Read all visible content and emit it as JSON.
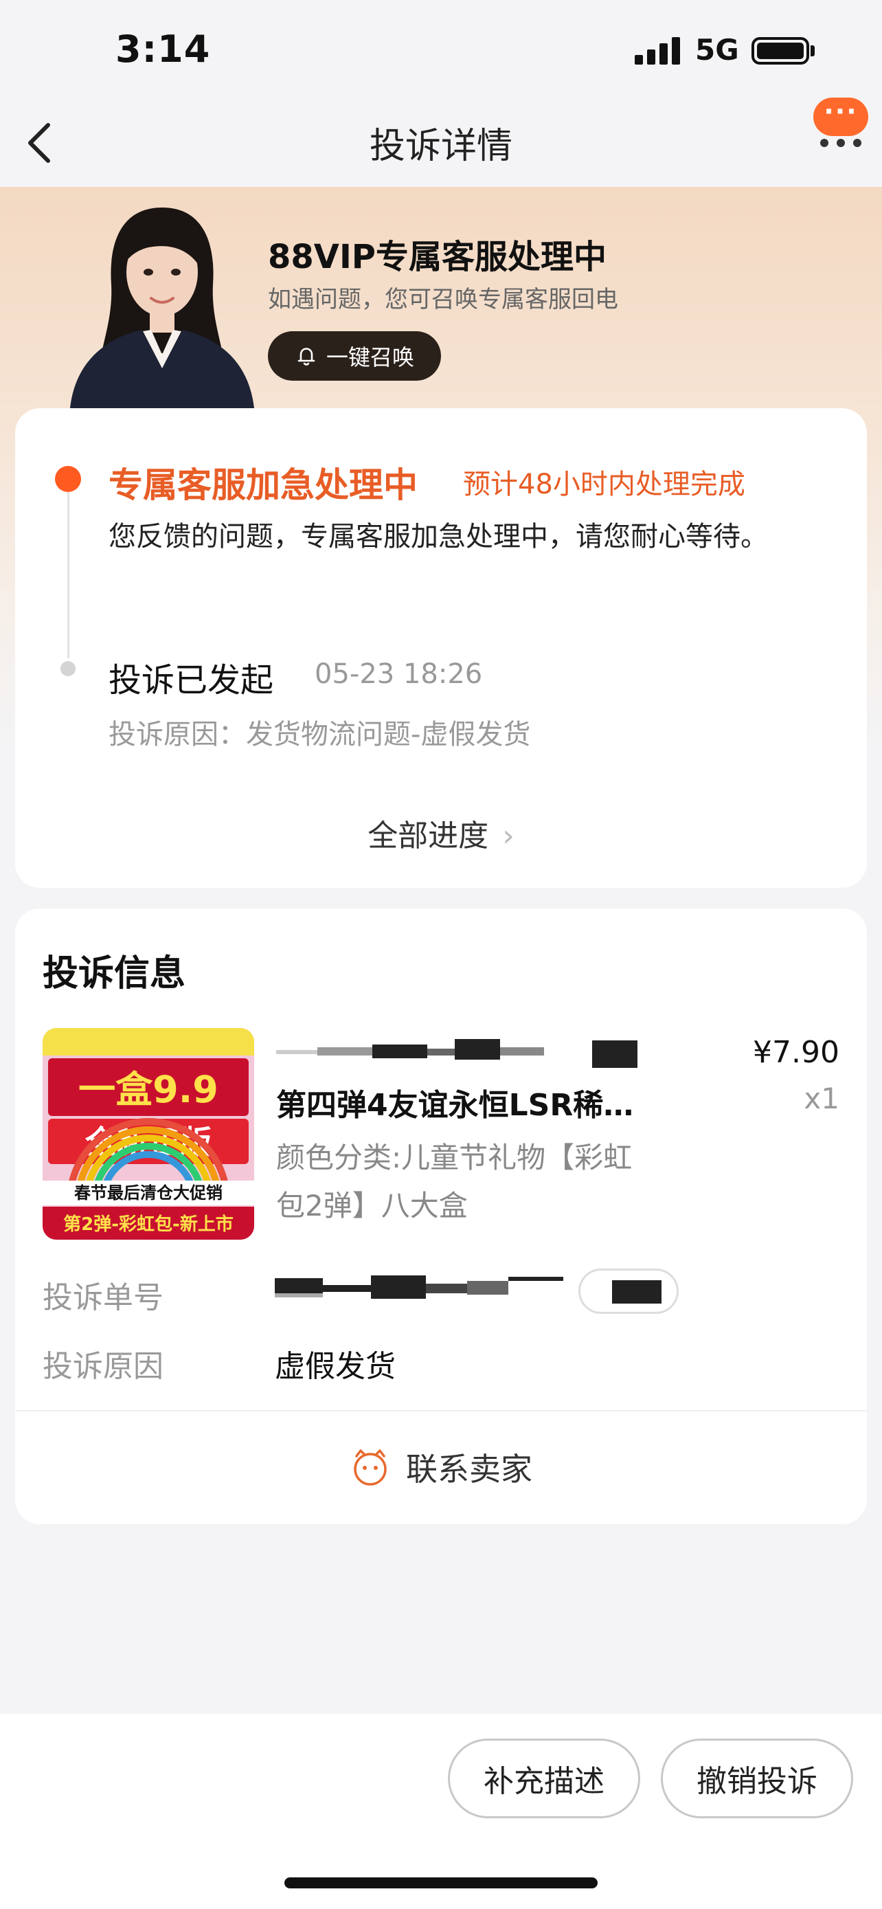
{
  "status_bar": {
    "time": "3:14",
    "network": "5G"
  },
  "nav": {
    "title": "投诉详情",
    "more_bubble": "···"
  },
  "banner": {
    "title": "88VIP专属客服处理中",
    "subtitle": "如遇问题，您可召唤专属客服回电",
    "summon_label": "一键召唤"
  },
  "progress": {
    "step1_title": "专属客服加急处理中",
    "step1_eta": "预计48小时内处理完成",
    "step1_desc": "您反馈的问题，专属客服加急处理中，请您耐心等待。",
    "step2_title": "投诉已发起",
    "step2_time": "05-23 18:26",
    "step2_reason": "投诉原因：发货物流问题-虚假发货",
    "all_progress": "全部进度"
  },
  "info": {
    "title": "投诉信息",
    "product": {
      "name": "第四弹4友谊永恒LSR稀…",
      "spec": "颜色分类:儿童节礼物【彩虹包2弹】八大盒",
      "price": "¥7.90",
      "qty": "x1",
      "thumb_text_top": "一盒9.9",
      "thumb_text_mid": "全新正版",
      "thumb_text_sale": "春节最后清仓大促销",
      "thumb_text_bottom": "第2弹-彩虹包-新上市"
    },
    "order_label": "投诉单号",
    "reason_label": "投诉原因",
    "reason_value": "虚假发货",
    "contact_label": "联系卖家"
  },
  "bottom": {
    "supplement_label": "补充描述",
    "withdraw_label": "撤销投诉"
  },
  "colors": {
    "accent": "#ff5a1f",
    "accent_text": "#e85d26",
    "dark_button": "#2b211b"
  }
}
